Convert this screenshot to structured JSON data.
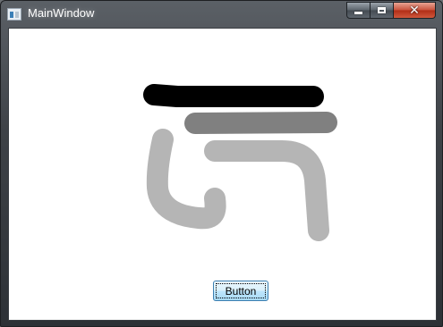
{
  "window": {
    "title": "MainWindow",
    "icon": "app-window-icon"
  },
  "caption_buttons": {
    "minimize_icon": "minimize-icon",
    "maximize_icon": "maximize-icon",
    "close_icon": "close-icon",
    "close_glyph": "✕"
  },
  "content": {
    "button_label": "Button"
  },
  "colors": {
    "stroke_black": "#000000",
    "stroke_dark_gray": "#808080",
    "stroke_light_gray": "#b5b5b5",
    "button_border": "#3c7fb1"
  }
}
